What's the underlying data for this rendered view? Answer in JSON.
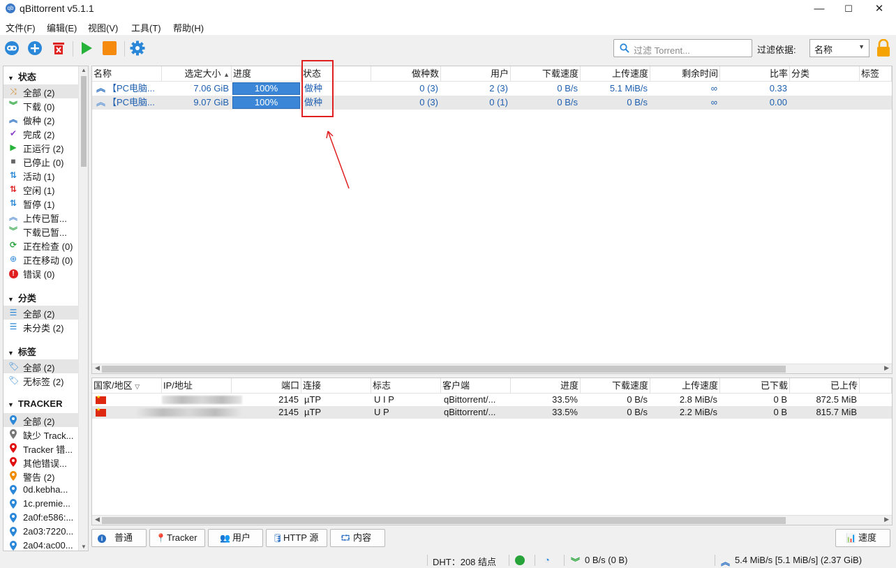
{
  "window": {
    "title": "qBittorrent v5.1.1",
    "icon_text": "qb",
    "min": "—",
    "max": "☐",
    "close": "✕"
  },
  "menu": [
    "文件(F)",
    "编辑(E)",
    "视图(V)",
    "工具(T)",
    "帮助(H)"
  ],
  "toolbar": {
    "search_placeholder": "过滤 Torrent...",
    "filter_label": "过滤依据:",
    "filter_value": "名称"
  },
  "sidebar": {
    "status_title": "状态",
    "status_items": [
      {
        "label": "全部 (2)",
        "icon": "all-icon"
      },
      {
        "label": "下载 (0)",
        "icon": "download-icon"
      },
      {
        "label": "做种 (2)",
        "icon": "seeding-icon"
      },
      {
        "label": "完成 (2)",
        "icon": "check-icon"
      },
      {
        "label": "正运行 (2)",
        "icon": "play-icon"
      },
      {
        "label": "已停止 (0)",
        "icon": "stop-icon"
      },
      {
        "label": "活动 (1)",
        "icon": "active-icon"
      },
      {
        "label": "空闲 (1)",
        "icon": "idle-icon"
      },
      {
        "label": "暂停 (1)",
        "icon": "stalled-icon"
      },
      {
        "label": "上传已暂...",
        "icon": "upload-paused-icon"
      },
      {
        "label": "下载已暂...",
        "icon": "download-paused-icon"
      },
      {
        "label": "正在检查 (0)",
        "icon": "checking-icon"
      },
      {
        "label": "正在移动 (0)",
        "icon": "moving-icon"
      },
      {
        "label": "错误 (0)",
        "icon": "error-icon"
      }
    ],
    "category_title": "分类",
    "category_items": [
      {
        "label": "全部 (2)"
      },
      {
        "label": "未分类 (2)"
      }
    ],
    "tag_title": "标签",
    "tag_items": [
      {
        "label": "全部 (2)"
      },
      {
        "label": "无标签 (2)"
      }
    ],
    "tracker_title": "TRACKER",
    "tracker_items": [
      {
        "label": "全部 (2)",
        "color": "#2b87d8"
      },
      {
        "label": "缺少 Track...",
        "color": "#777777"
      },
      {
        "label": "Tracker 错...",
        "color": "#e01010"
      },
      {
        "label": "其他错误...",
        "color": "#e01010"
      },
      {
        "label": "警告 (2)",
        "color": "#f08a00"
      },
      {
        "label": "0d.kebha...",
        "color": "#2b87d8"
      },
      {
        "label": "1c.premie...",
        "color": "#2b87d8"
      },
      {
        "label": "2a0f:e586:...",
        "color": "#2b87d8"
      },
      {
        "label": "2a03:7220...",
        "color": "#2b87d8"
      },
      {
        "label": "2a04:ac00...",
        "color": "#2b87d8"
      }
    ]
  },
  "torrents": {
    "headers": [
      "名称",
      "选定大小",
      "进度",
      "状态",
      "做种数",
      "用户",
      "下载速度",
      "上传速度",
      "剩余时间",
      "比率",
      "分类",
      "标签"
    ],
    "rows": [
      {
        "name": "【PC电脑...",
        "size": "7.06 GiB",
        "progress": 100,
        "progress_text": "100%",
        "status": "做种",
        "seeds": "0 (3)",
        "peers": "2 (3)",
        "dl": "0 B/s",
        "ul": "5.1 MiB/s",
        "eta": "∞",
        "ratio": "0.33"
      },
      {
        "name": "【PC电脑...",
        "size": "9.07 GiB",
        "progress": 100,
        "progress_text": "100%",
        "status": "做种",
        "seeds": "0 (3)",
        "peers": "0 (1)",
        "dl": "0 B/s",
        "ul": "0 B/s",
        "eta": "∞",
        "ratio": "0.00"
      }
    ]
  },
  "peers": {
    "headers": [
      "国家/地区",
      "IP/地址",
      "端口",
      "连接",
      "标志",
      "客户端",
      "进度",
      "下载速度",
      "上传速度",
      "已下载",
      "已上传"
    ],
    "rows": [
      {
        "port": "2145",
        "conn": "µTP",
        "flags": "U I P",
        "client": "qBittorrent/...",
        "progress": "33.5%",
        "dl": "0 B/s",
        "ul": "2.8 MiB/s",
        "downloaded": "0 B",
        "uploaded": "872.5 MiB"
      },
      {
        "port": "2145",
        "conn": "µTP",
        "flags": "U P",
        "client": "qBittorrent/...",
        "progress": "33.5%",
        "dl": "0 B/s",
        "ul": "2.2 MiB/s",
        "downloaded": "0 B",
        "uploaded": "815.7 MiB"
      }
    ]
  },
  "tabs": [
    "普通",
    "Tracker",
    "用户",
    "HTTP 源",
    "内容"
  ],
  "speed_button": "速度",
  "status": {
    "dht": "DHT：208 结点",
    "download": "0 B/s (0 B)",
    "upload": "5.4 MiB/s [5.1 MiB/s] (2.37 GiB)"
  },
  "colors": {
    "accent": "#1e5fb0",
    "progress": "#3b86d6",
    "annotation": "#e02020"
  }
}
